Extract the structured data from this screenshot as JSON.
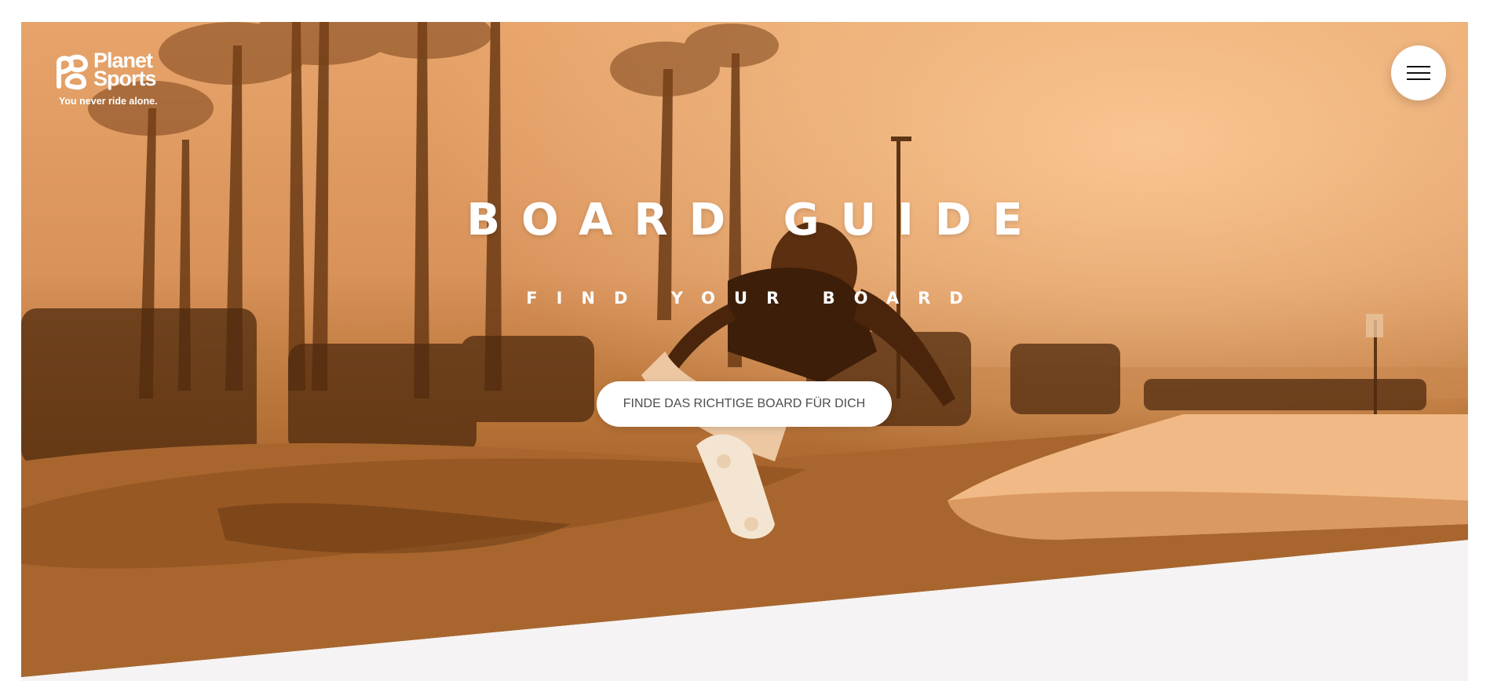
{
  "brand": {
    "name": "Planet\nSports",
    "tagline": "You never ride alone.",
    "logo_icon": "planet-sports-logo-icon"
  },
  "header": {
    "menu_icon": "hamburger-menu-icon"
  },
  "hero": {
    "title": "BOARD GUIDE",
    "subtitle": "FIND YOUR BOARD",
    "cta_label": "FINDE DAS RICHTIGE BOARD FÜR DICH",
    "image_subject": "skateboarder-in-skatepark-photo",
    "tint_color": "#d8925a",
    "section_background": "#f5f3f3"
  }
}
